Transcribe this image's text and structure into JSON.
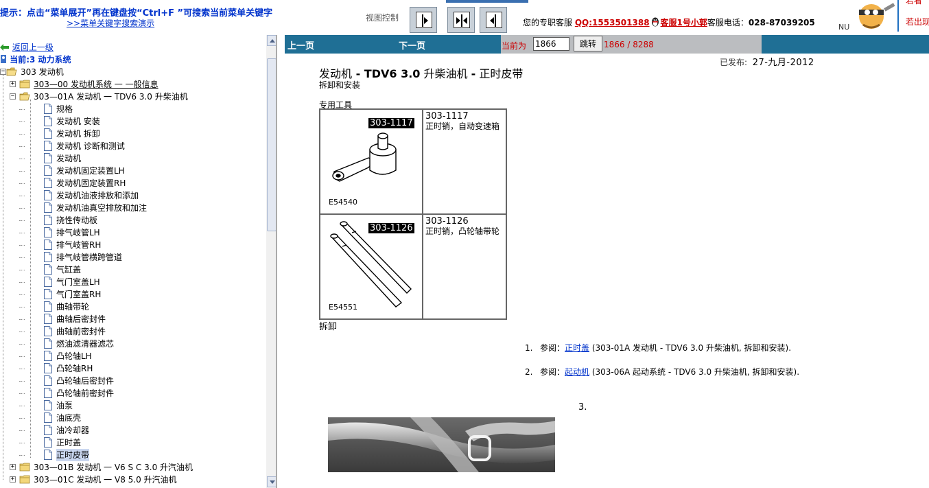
{
  "banner": {
    "hint_line1": "提示：点击“菜单展开”再在键盘按“Ctrl+F ”可搜索当前菜单关键字",
    "hint_line2": ">>菜单关键字搜索演示",
    "view_control_label": "视图控制",
    "customer_service_prefix": "您的专职客服",
    "qq": "QQ:1553501388",
    "service_name": "客服1号小郭",
    "phone_label": "客服电话：",
    "phone": "028-87039205",
    "right_text_1": "若看",
    "right_text_2": "若出现",
    "nu_text": "NU"
  },
  "sidebar": {
    "back_link": "返回上一级",
    "current": "当前:3 动力系统",
    "tree": [
      {
        "indent": 0,
        "expander": "minus",
        "icon": "folder-open",
        "label": "303 发动机"
      },
      {
        "indent": 1,
        "expander": "plus",
        "icon": "folder",
        "label": "303—00 发动机系统 一 一般信息",
        "underline": true
      },
      {
        "indent": 1,
        "expander": "minus",
        "icon": "folder-open",
        "label": "303—01A 发动机 一 TDV6 3.0 升柴油机"
      },
      {
        "indent": 2,
        "icon": "doc",
        "label": "规格"
      },
      {
        "indent": 2,
        "icon": "doc",
        "label": "发动机 安装"
      },
      {
        "indent": 2,
        "icon": "doc",
        "label": "发动机 拆卸"
      },
      {
        "indent": 2,
        "icon": "doc",
        "label": "发动机 诊断和测试"
      },
      {
        "indent": 2,
        "icon": "doc",
        "label": "发动机"
      },
      {
        "indent": 2,
        "icon": "doc",
        "label": "发动机固定装置LH"
      },
      {
        "indent": 2,
        "icon": "doc",
        "label": "发动机固定装置RH"
      },
      {
        "indent": 2,
        "icon": "doc",
        "label": "发动机油液排放和添加"
      },
      {
        "indent": 2,
        "icon": "doc",
        "label": "发动机油真空排放和加注"
      },
      {
        "indent": 2,
        "icon": "doc",
        "label": "挠性传动板"
      },
      {
        "indent": 2,
        "icon": "doc",
        "label": "排气岐管LH"
      },
      {
        "indent": 2,
        "icon": "doc",
        "label": "排气岐管RH"
      },
      {
        "indent": 2,
        "icon": "doc",
        "label": "排气岐管横跨管道"
      },
      {
        "indent": 2,
        "icon": "doc",
        "label": "气缸盖"
      },
      {
        "indent": 2,
        "icon": "doc",
        "label": "气门室盖LH"
      },
      {
        "indent": 2,
        "icon": "doc",
        "label": "气门室盖RH"
      },
      {
        "indent": 2,
        "icon": "doc",
        "label": "曲轴带轮"
      },
      {
        "indent": 2,
        "icon": "doc",
        "label": "曲轴后密封件"
      },
      {
        "indent": 2,
        "icon": "doc",
        "label": "曲轴前密封件"
      },
      {
        "indent": 2,
        "icon": "doc",
        "label": "燃油滤清器滤芯"
      },
      {
        "indent": 2,
        "icon": "doc",
        "label": "凸轮轴LH"
      },
      {
        "indent": 2,
        "icon": "doc",
        "label": "凸轮轴RH"
      },
      {
        "indent": 2,
        "icon": "doc",
        "label": "凸轮轴后密封件"
      },
      {
        "indent": 2,
        "icon": "doc",
        "label": "凸轮轴前密封件"
      },
      {
        "indent": 2,
        "icon": "doc",
        "label": "油泵"
      },
      {
        "indent": 2,
        "icon": "doc",
        "label": "油底壳"
      },
      {
        "indent": 2,
        "icon": "doc",
        "label": "油冷却器"
      },
      {
        "indent": 2,
        "icon": "doc",
        "label": "正时盖"
      },
      {
        "indent": 2,
        "icon": "doc",
        "label": "正时皮带",
        "selected": true
      },
      {
        "indent": 1,
        "expander": "plus",
        "icon": "folder",
        "label": "303—01B 发动机 一 V6 S C 3.0 升汽油机"
      },
      {
        "indent": 1,
        "expander": "plus",
        "icon": "folder",
        "label": "303—01C 发动机 一 V8 5.0 升汽油机"
      }
    ]
  },
  "navbar": {
    "prev": "上一页",
    "next": "下一页",
    "current_label": "当前为",
    "page_value": "1866",
    "goto_button": "跳转",
    "page_count": "1866 / 8288"
  },
  "document": {
    "published_label": "已发布:",
    "published_date": "27-九月-2012",
    "title_part1": "发动机",
    "title_sep1": " - ",
    "title_part2": "TDV6 3.0",
    "title_part3": " 升柴油机 ",
    "title_sep2": "-",
    "title_part4": " 正时皮带",
    "subtitle": "拆卸和安装",
    "tools_label": "专用工具",
    "tools": [
      {
        "tag": "303-1117",
        "image_code": "E54540",
        "number": "303-1117",
        "description": "正时销，自动变速箱"
      },
      {
        "tag": "303-1126",
        "image_code": "E54551",
        "number": "303-1126",
        "description": "正时销，凸轮轴带轮"
      }
    ],
    "removal_heading": "拆卸",
    "steps": [
      {
        "num": "1.",
        "prefix": "参阅：",
        "link": "正时盖",
        "rest": " (303-01A 发动机 - TDV6 3.0 升柴油机, 拆卸和安装)."
      },
      {
        "num": "2.",
        "prefix": "参阅：",
        "link": "起动机",
        "rest": " (303-06A 起动系统 - TDV6 3.0 升柴油机, 拆卸和安装)."
      }
    ],
    "step3_num": "3."
  }
}
